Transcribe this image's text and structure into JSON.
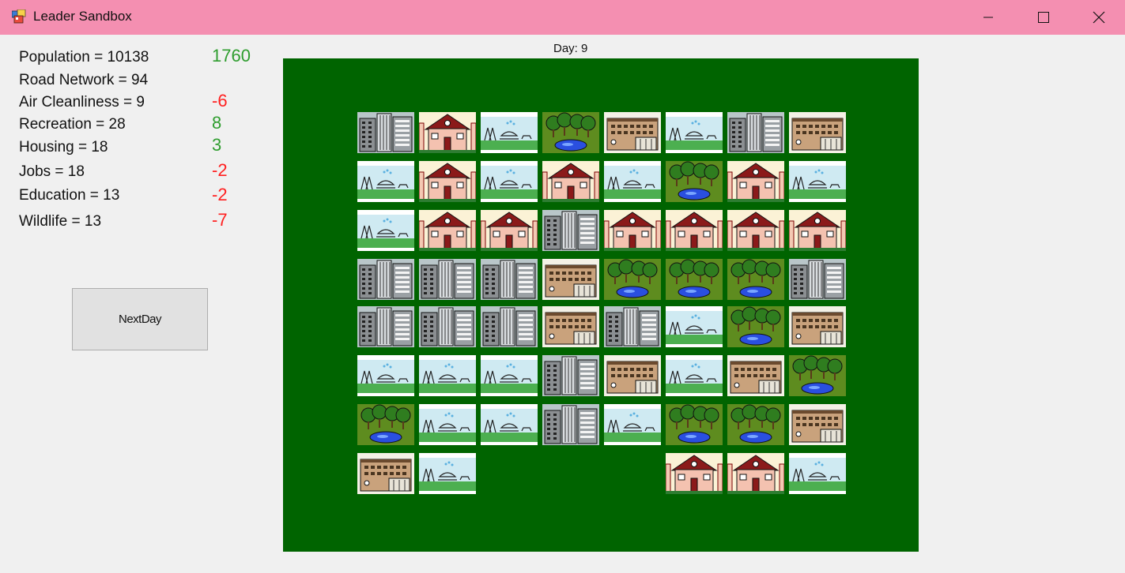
{
  "window": {
    "title": "Leader Sandbox",
    "icon": "app-window-icon"
  },
  "stats": [
    {
      "label": "Population = 10138",
      "change": "1760",
      "change_color": "#2e9d2e"
    },
    {
      "label": "Road Network = 94",
      "change": "",
      "change_color": "#2e9d2e"
    },
    {
      "label": "Air Cleanliness = 9",
      "change": "-6",
      "change_color": "#ff2020"
    },
    {
      "label": "Recreation = 28",
      "change": "8",
      "change_color": "#2e9d2e"
    },
    {
      "label": "Housing = 18",
      "change": "3",
      "change_color": "#2e9d2e"
    },
    {
      "label": "Jobs = 18",
      "change": "-2",
      "change_color": "#ff2020"
    },
    {
      "label": "Education = 13",
      "change": "-2",
      "change_color": "#ff2020"
    },
    {
      "label": "Wildlife = 13",
      "change": "-7",
      "change_color": "#ff2020"
    }
  ],
  "next_button_label": "NextDay",
  "day_label": "Day: 9",
  "board": {
    "background": "#006400",
    "grid": [
      [
        "office",
        "house",
        "playground",
        "forest",
        "school",
        "playground",
        "office",
        "school"
      ],
      [
        "playground",
        "house",
        "playground",
        "house",
        "playground",
        "forest",
        "house",
        "playground"
      ],
      [
        "playground",
        "house",
        "house",
        "office",
        "house",
        "house",
        "house",
        "house"
      ],
      [
        "office",
        "office",
        "office",
        "school",
        "forest",
        "forest",
        "forest",
        "office"
      ],
      [
        "office",
        "office",
        "office",
        "school",
        "office",
        "playground",
        "forest",
        "school"
      ],
      [
        "playground",
        "playground",
        "playground",
        "office",
        "school",
        "playground",
        "school",
        "forest"
      ],
      [
        "forest",
        "playground",
        "playground",
        "office",
        "playground",
        "forest",
        "forest",
        "school"
      ],
      [
        "school",
        "playground",
        null,
        null,
        null,
        "house",
        "house",
        "playground"
      ]
    ]
  }
}
